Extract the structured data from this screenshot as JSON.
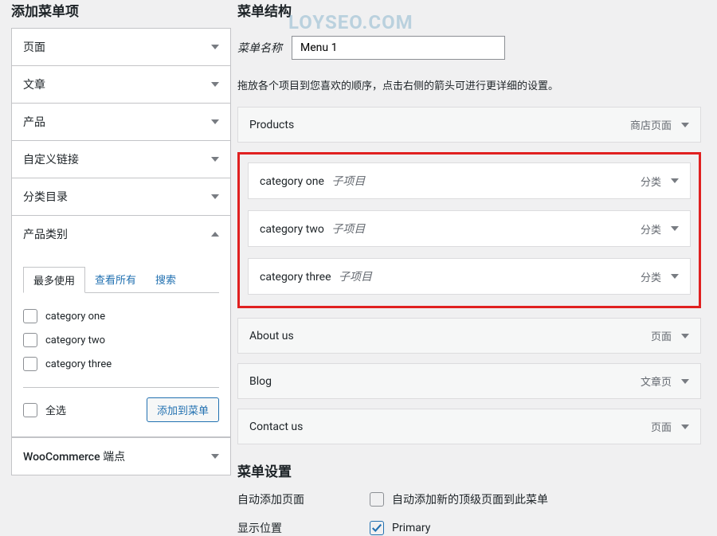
{
  "sidebar": {
    "title": "添加菜单项",
    "accordions": {
      "page": "页面",
      "post": "文章",
      "product": "产品",
      "custom_link": "自定义链接",
      "category": "分类目录",
      "product_cat": "产品类别",
      "woocommerce": "WooCommerce 端点"
    },
    "tabs": {
      "most_used": "最多使用",
      "view_all": "查看所有",
      "search": "搜索"
    },
    "categories": [
      "category one",
      "category two",
      "category three"
    ],
    "select_all": "全选",
    "add_to_menu": "添加到菜单"
  },
  "main": {
    "title": "菜单结构",
    "menu_name_label": "菜单名称",
    "menu_name_value": "Menu 1",
    "description": "拖放各个项目到您喜欢的顺序，点击右侧的箭头可进行更详细的设置。",
    "items": {
      "products": {
        "label": "Products",
        "type": "商店页面"
      },
      "cat1": {
        "label": "category one",
        "sub": "子项目",
        "type": "分类"
      },
      "cat2": {
        "label": "category two",
        "sub": "子项目",
        "type": "分类"
      },
      "cat3": {
        "label": "category three",
        "sub": "子项目",
        "type": "分类"
      },
      "about": {
        "label": "About us",
        "type": "页面"
      },
      "blog": {
        "label": "Blog",
        "type": "文章页"
      },
      "contact": {
        "label": "Contact us",
        "type": "页面"
      }
    },
    "settings": {
      "title": "菜单设置",
      "auto_add_label": "自动添加页面",
      "auto_add_desc": "自动添加新的顶级页面到此菜单",
      "display_label": "显示位置",
      "display_value": "Primary"
    }
  }
}
